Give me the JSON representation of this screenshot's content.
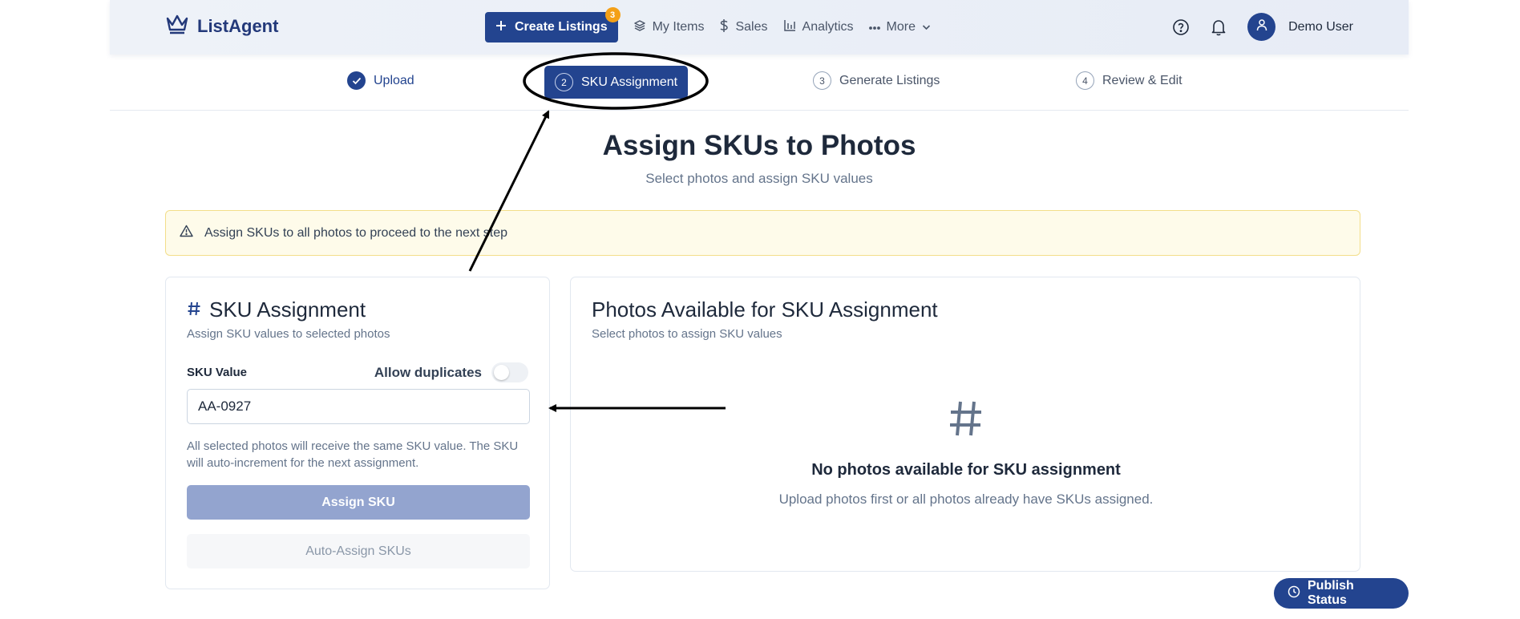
{
  "brand": {
    "name": "ListAgent"
  },
  "nav": {
    "create": {
      "label": "Create Listings",
      "badge": "3"
    },
    "items": [
      {
        "label": "My Items",
        "icon": "layers-icon"
      },
      {
        "label": "Sales",
        "icon": "dollar-icon"
      },
      {
        "label": "Analytics",
        "icon": "bar-chart-icon"
      },
      {
        "label": "More",
        "icon": "ellipsis-icon"
      }
    ]
  },
  "user": {
    "name": "Demo User"
  },
  "stepper": [
    {
      "num": "",
      "label": "Upload",
      "state": "done"
    },
    {
      "num": "2",
      "label": "SKU Assignment",
      "state": "active"
    },
    {
      "num": "3",
      "label": "Generate Listings",
      "state": "pending"
    },
    {
      "num": "4",
      "label": "Review & Edit",
      "state": "pending"
    }
  ],
  "page": {
    "title": "Assign SKUs to Photos",
    "subtitle": "Select photos and assign SKU values"
  },
  "alert": {
    "text": "Assign SKUs to all photos to proceed to the next step"
  },
  "sku_panel": {
    "title": "SKU Assignment",
    "subtitle": "Assign SKU values to selected photos",
    "field_label": "SKU Value",
    "duplicates_label": "Allow duplicates",
    "duplicates_enabled": false,
    "input_value": "AA-0927",
    "help": "All selected photos will receive the same SKU value. The SKU will auto-increment for the next assignment.",
    "assign_label": "Assign SKU",
    "auto_label": "Auto-Assign SKUs"
  },
  "photos_panel": {
    "title": "Photos Available for SKU Assignment",
    "subtitle": "Select photos to assign SKU values",
    "empty_title": "No photos available for SKU assignment",
    "empty_sub": "Upload photos first or all photos already have SKUs assigned."
  },
  "publish": {
    "label": "Publish Status"
  },
  "colors": {
    "primary": "#23448f",
    "badge": "#f4a017",
    "alert_bg": "#fefbea",
    "alert_border": "#f3de8a"
  }
}
